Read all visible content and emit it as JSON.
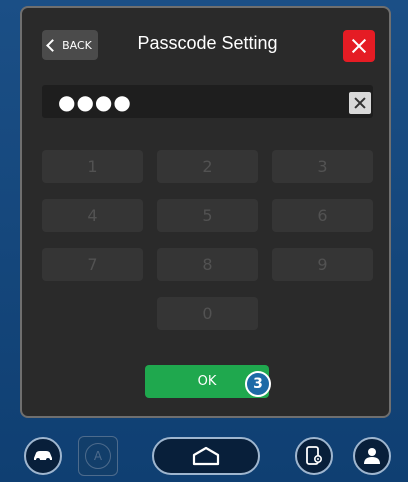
{
  "header": {
    "back_label": "BACK",
    "title": "Passcode Setting"
  },
  "passcode": {
    "masked_value": "●●●●"
  },
  "keypad": {
    "keys": [
      "1",
      "2",
      "3",
      "4",
      "5",
      "6",
      "7",
      "8",
      "9",
      "0"
    ]
  },
  "actions": {
    "ok_label": "OK",
    "step_number": "3"
  },
  "dock": {
    "auto_label": "A"
  },
  "colors": {
    "close_red": "#e51c24",
    "ok_green": "#1fa84e",
    "dock_blue": "#0e4f86"
  },
  "icons": [
    "chevron-left-icon",
    "close-icon",
    "clear-icon",
    "car-icon",
    "auto-icon",
    "home-icon",
    "phone-settings-icon",
    "user-icon"
  ]
}
